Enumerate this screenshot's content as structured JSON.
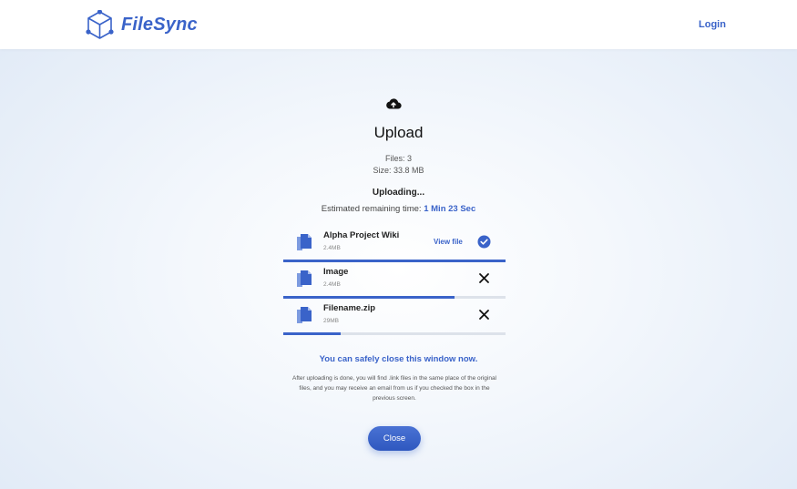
{
  "header": {
    "brand": "FileSync",
    "login_label": "Login",
    "accent_color": "#3a63c9"
  },
  "upload": {
    "title": "Upload",
    "files_text": "Files: 3",
    "size_text": "Size: 33.8 MB",
    "status_text": "Uploading...",
    "eta_prefix": "Estimated remaining time:",
    "eta_value": "1 Min 23 Sec"
  },
  "files": [
    {
      "name": "Alpha Project Wiki",
      "size": "2.4MB",
      "progress": 1.0,
      "state": "done",
      "action_label": "View file",
      "action_icon": "check-circle-icon"
    },
    {
      "name": "Image",
      "size": "2.4MB",
      "progress": 0.77,
      "state": "uploading",
      "action_icon": "close-icon"
    },
    {
      "name": "Filename.zip",
      "size": "29MB",
      "progress": 0.26,
      "state": "uploading",
      "action_icon": "close-icon"
    }
  ],
  "footer": {
    "safe_text": "You can safely close this window now.",
    "note_text": "After uploading is done, you will find .link files in the same place of the original files, and you may receive an email from us if you checked the box in the previous screen.",
    "close_label": "Close"
  }
}
